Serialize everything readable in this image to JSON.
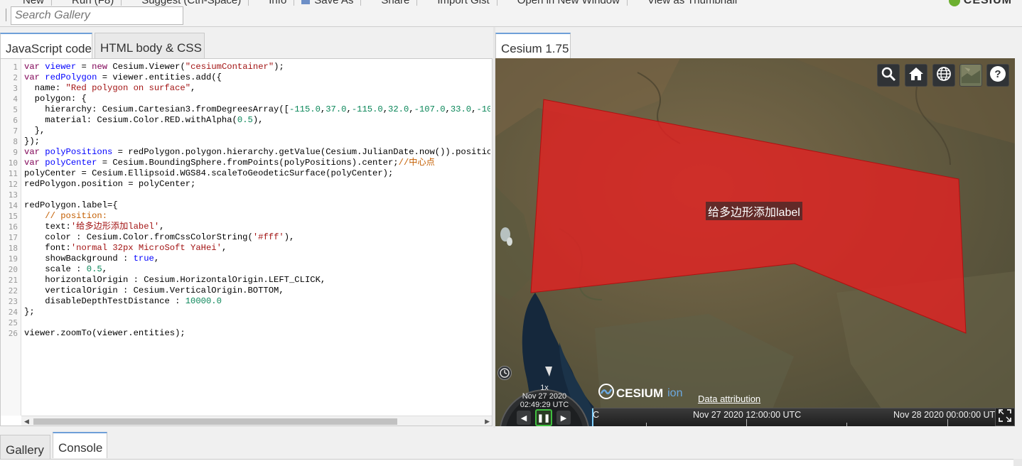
{
  "toolbar": {
    "items": [
      {
        "label": "New"
      },
      {
        "label": "Run (F8)"
      },
      {
        "label": "Suggest (Ctrl-Space)"
      },
      {
        "label": "Info"
      },
      {
        "label": "Save As"
      },
      {
        "label": "Share"
      },
      {
        "label": "Import Gist"
      },
      {
        "label": "Open in New Window"
      },
      {
        "label": "View as Thumbnail"
      }
    ],
    "logo": "CESIUM",
    "search_placeholder": "Search Gallery"
  },
  "left_tabs": [
    {
      "label": "JavaScript code",
      "active": true
    },
    {
      "label": "HTML body & CSS",
      "active": false
    }
  ],
  "editor": {
    "line_numbers": [
      "1",
      "2",
      "3",
      "4",
      "5",
      "6",
      "7",
      "8",
      "9",
      "10",
      "11",
      "12",
      "13",
      "14",
      "15",
      "16",
      "17",
      "18",
      "19",
      "20",
      "21",
      "22",
      "23",
      "24",
      "25",
      "26"
    ]
  },
  "viewer_tab": {
    "label": "Cesium 1.75"
  },
  "viewer": {
    "polygon_label": "给多边形添加label",
    "polygon_color": "#e02222",
    "toolbar_buttons": [
      "search-icon",
      "home-icon",
      "globe-icon",
      "imagery-icon",
      "help-icon"
    ],
    "animation": {
      "speed": "1x",
      "date": "Nov 27 2020",
      "time": "02:49:29 UTC"
    },
    "credit": {
      "logo_text": "CESIUM",
      "logo_suffix": "ion",
      "attribution": "Data attribution"
    },
    "timeline": {
      "left_label": "C",
      "mid_label": "Nov 27 2020 12:00:00 UTC",
      "right_label": "Nov 28 2020 00:00:00 UT"
    }
  },
  "bottom_tabs": [
    {
      "label": "Gallery",
      "active": false
    },
    {
      "label": "Console",
      "active": true
    }
  ]
}
